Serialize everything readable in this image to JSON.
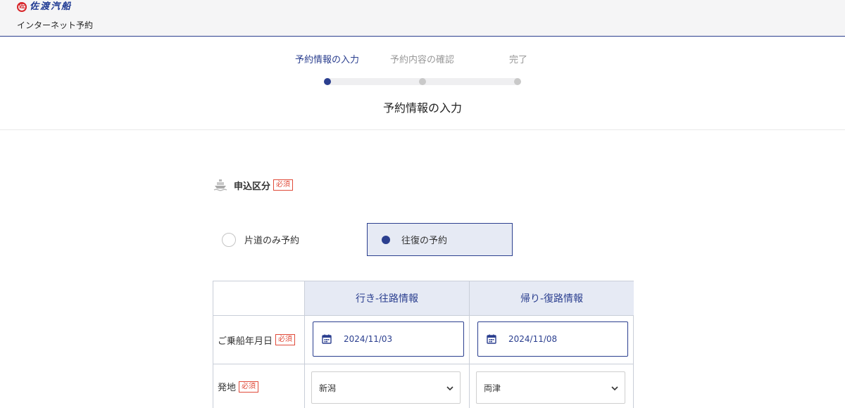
{
  "header": {
    "logo_text": "佐渡汽船",
    "logo_mark": "佐",
    "subtitle": "インターネット予約"
  },
  "stepper": {
    "steps": [
      {
        "label": "予約情報の入力",
        "active": true
      },
      {
        "label": "予約内容の確認",
        "active": false
      },
      {
        "label": "完了",
        "active": false
      }
    ],
    "title": "予約情報の入力"
  },
  "section": {
    "icon": "ship-icon",
    "label": "申込区分",
    "required": "必須"
  },
  "trip_type": {
    "options": [
      {
        "label": "片道のみ予約",
        "selected": false
      },
      {
        "label": "往復の予約",
        "selected": true
      }
    ]
  },
  "table": {
    "headers": [
      "行き-往路情報",
      "帰り-復路情報"
    ],
    "rows": {
      "date": {
        "label": "ご乗船年月日",
        "required": "必須",
        "outbound": "2024/11/03",
        "return": "2024/11/08"
      },
      "departure": {
        "label": "発地",
        "required": "必須",
        "outbound": "新潟",
        "return": "両津"
      }
    }
  },
  "colors": {
    "brand": "#2b3f8f",
    "required": "#e04b3a",
    "header_bg": "#e6eaf4"
  }
}
